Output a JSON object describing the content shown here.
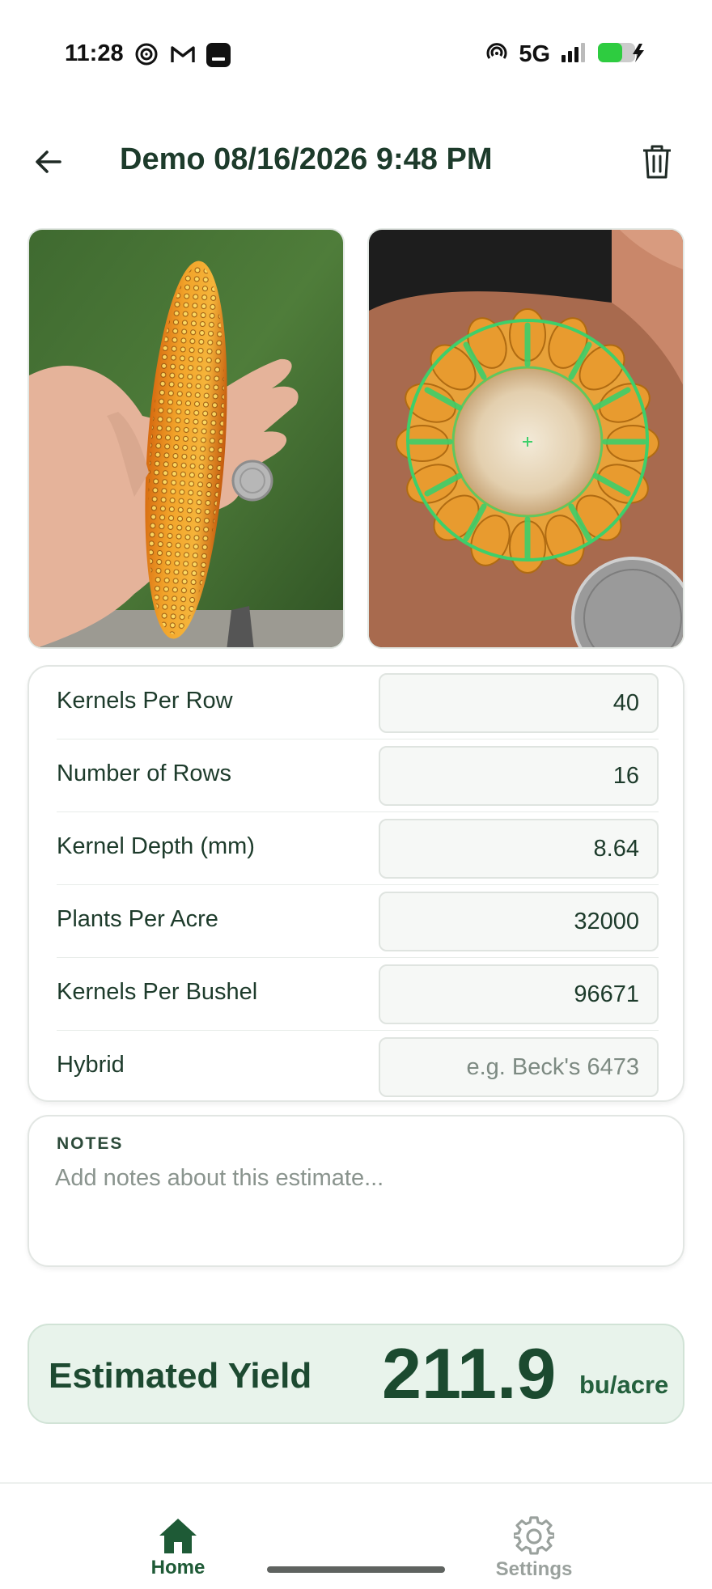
{
  "status_bar": {
    "time": "11:28",
    "network": "5G",
    "icons": [
      "target-icon",
      "gmail-icon",
      "app-icon",
      "hotspot-icon",
      "signal-icon",
      "battery-charging-icon"
    ]
  },
  "header": {
    "title": "Demo 08/16/2026 9:48 PM"
  },
  "photos": {
    "left": "ear-of-corn-photo",
    "right": "corn-cross-section-photo"
  },
  "fields": [
    {
      "label": "Kernels Per Row",
      "value": "40",
      "placeholder": ""
    },
    {
      "label": "Number of Rows",
      "value": "16",
      "placeholder": ""
    },
    {
      "label": "Kernel Depth (mm)",
      "value": "8.64",
      "placeholder": ""
    },
    {
      "label": "Plants Per Acre",
      "value": "32000",
      "placeholder": ""
    },
    {
      "label": "Kernels Per Bushel",
      "value": "96671",
      "placeholder": ""
    },
    {
      "label": "Hybrid",
      "value": "",
      "placeholder": "e.g. Beck's 6473"
    }
  ],
  "notes": {
    "label": "NOTES",
    "placeholder": "Add notes about this estimate..."
  },
  "yield": {
    "label": "Estimated Yield",
    "value": "211.9",
    "unit": "bu/acre"
  },
  "nav": {
    "home_label": "Home",
    "settings_label": "Settings"
  },
  "colors": {
    "accent": "#1e5a36",
    "yield_bg": "#e8f3eb",
    "overlay_green": "#3ecf6a"
  }
}
